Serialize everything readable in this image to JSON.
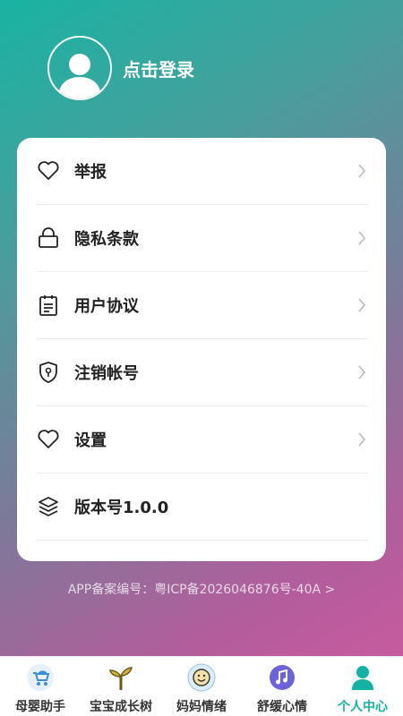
{
  "header": {
    "login_text": "点击登录"
  },
  "menu": [
    {
      "label": "举报",
      "icon": "heart-icon"
    },
    {
      "label": "隐私条款",
      "icon": "lock-icon"
    },
    {
      "label": "用户协议",
      "icon": "clipboard-icon"
    },
    {
      "label": "注销帐号",
      "icon": "shield-icon"
    },
    {
      "label": "设置",
      "icon": "heart-icon"
    },
    {
      "label": "版本号1.0.0",
      "icon": "layers-icon"
    }
  ],
  "icp": "APP备案编号：粤ICP备2026046876号-40A >",
  "tabs": [
    {
      "label": "母婴助手",
      "icon": "stroller-icon"
    },
    {
      "label": "宝宝成长树",
      "icon": "sprout-icon"
    },
    {
      "label": "妈妈情绪",
      "icon": "smiley-icon"
    },
    {
      "label": "舒缓心情",
      "icon": "music-icon"
    },
    {
      "label": "个人中心",
      "icon": "person-icon",
      "active": true
    }
  ],
  "colors": {
    "accent": "#14b2a3",
    "gradient_start": "#19b3a3",
    "gradient_end": "#cf5aa0"
  }
}
